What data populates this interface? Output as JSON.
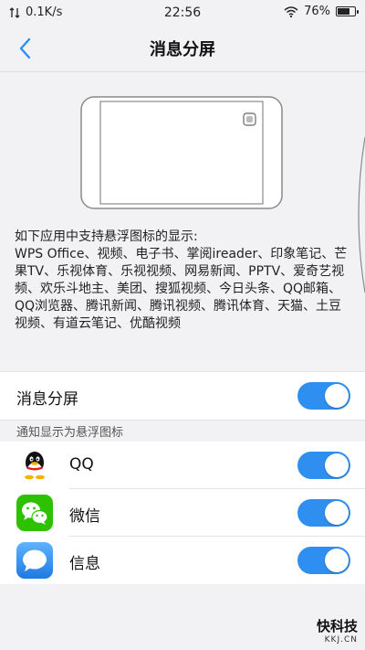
{
  "status_bar": {
    "network_speed": "0.1K/s",
    "time": "22:56",
    "battery_percent": "76%",
    "battery_level": 0.76
  },
  "nav": {
    "title": "消息分屏",
    "back_icon": "chevron-left-icon"
  },
  "description": {
    "line1": "如下应用中支持悬浮图标的显示:",
    "apps_text": "WPS Office、视频、电子书、掌阅ireader、印象笔记、芒果TV、乐视体育、乐视视频、网易新闻、PPTV、爱奇艺视频、欢乐斗地主、美团、搜狐视频、今日头条、QQ邮箱、QQ浏览器、腾讯新闻、腾讯视频、腾讯体育、天猫、土豆视频、有道云笔记、优酷视频"
  },
  "main_toggle": {
    "label": "消息分屏",
    "enabled": true
  },
  "section": {
    "header": "通知显示为悬浮图标",
    "apps": [
      {
        "name": "QQ",
        "icon": "qq-penguin-icon",
        "enabled": true
      },
      {
        "name": "微信",
        "icon": "wechat-icon",
        "enabled": true
      },
      {
        "name": "信息",
        "icon": "messages-icon",
        "enabled": true
      }
    ]
  },
  "colors": {
    "accent": "#2f8ff0",
    "background": "#f2f2f4",
    "wechat_green": "#2dc100",
    "messages_blue": "#2d8cf0"
  },
  "watermark": {
    "main": "快科技",
    "sub": "KKJ.CN"
  }
}
